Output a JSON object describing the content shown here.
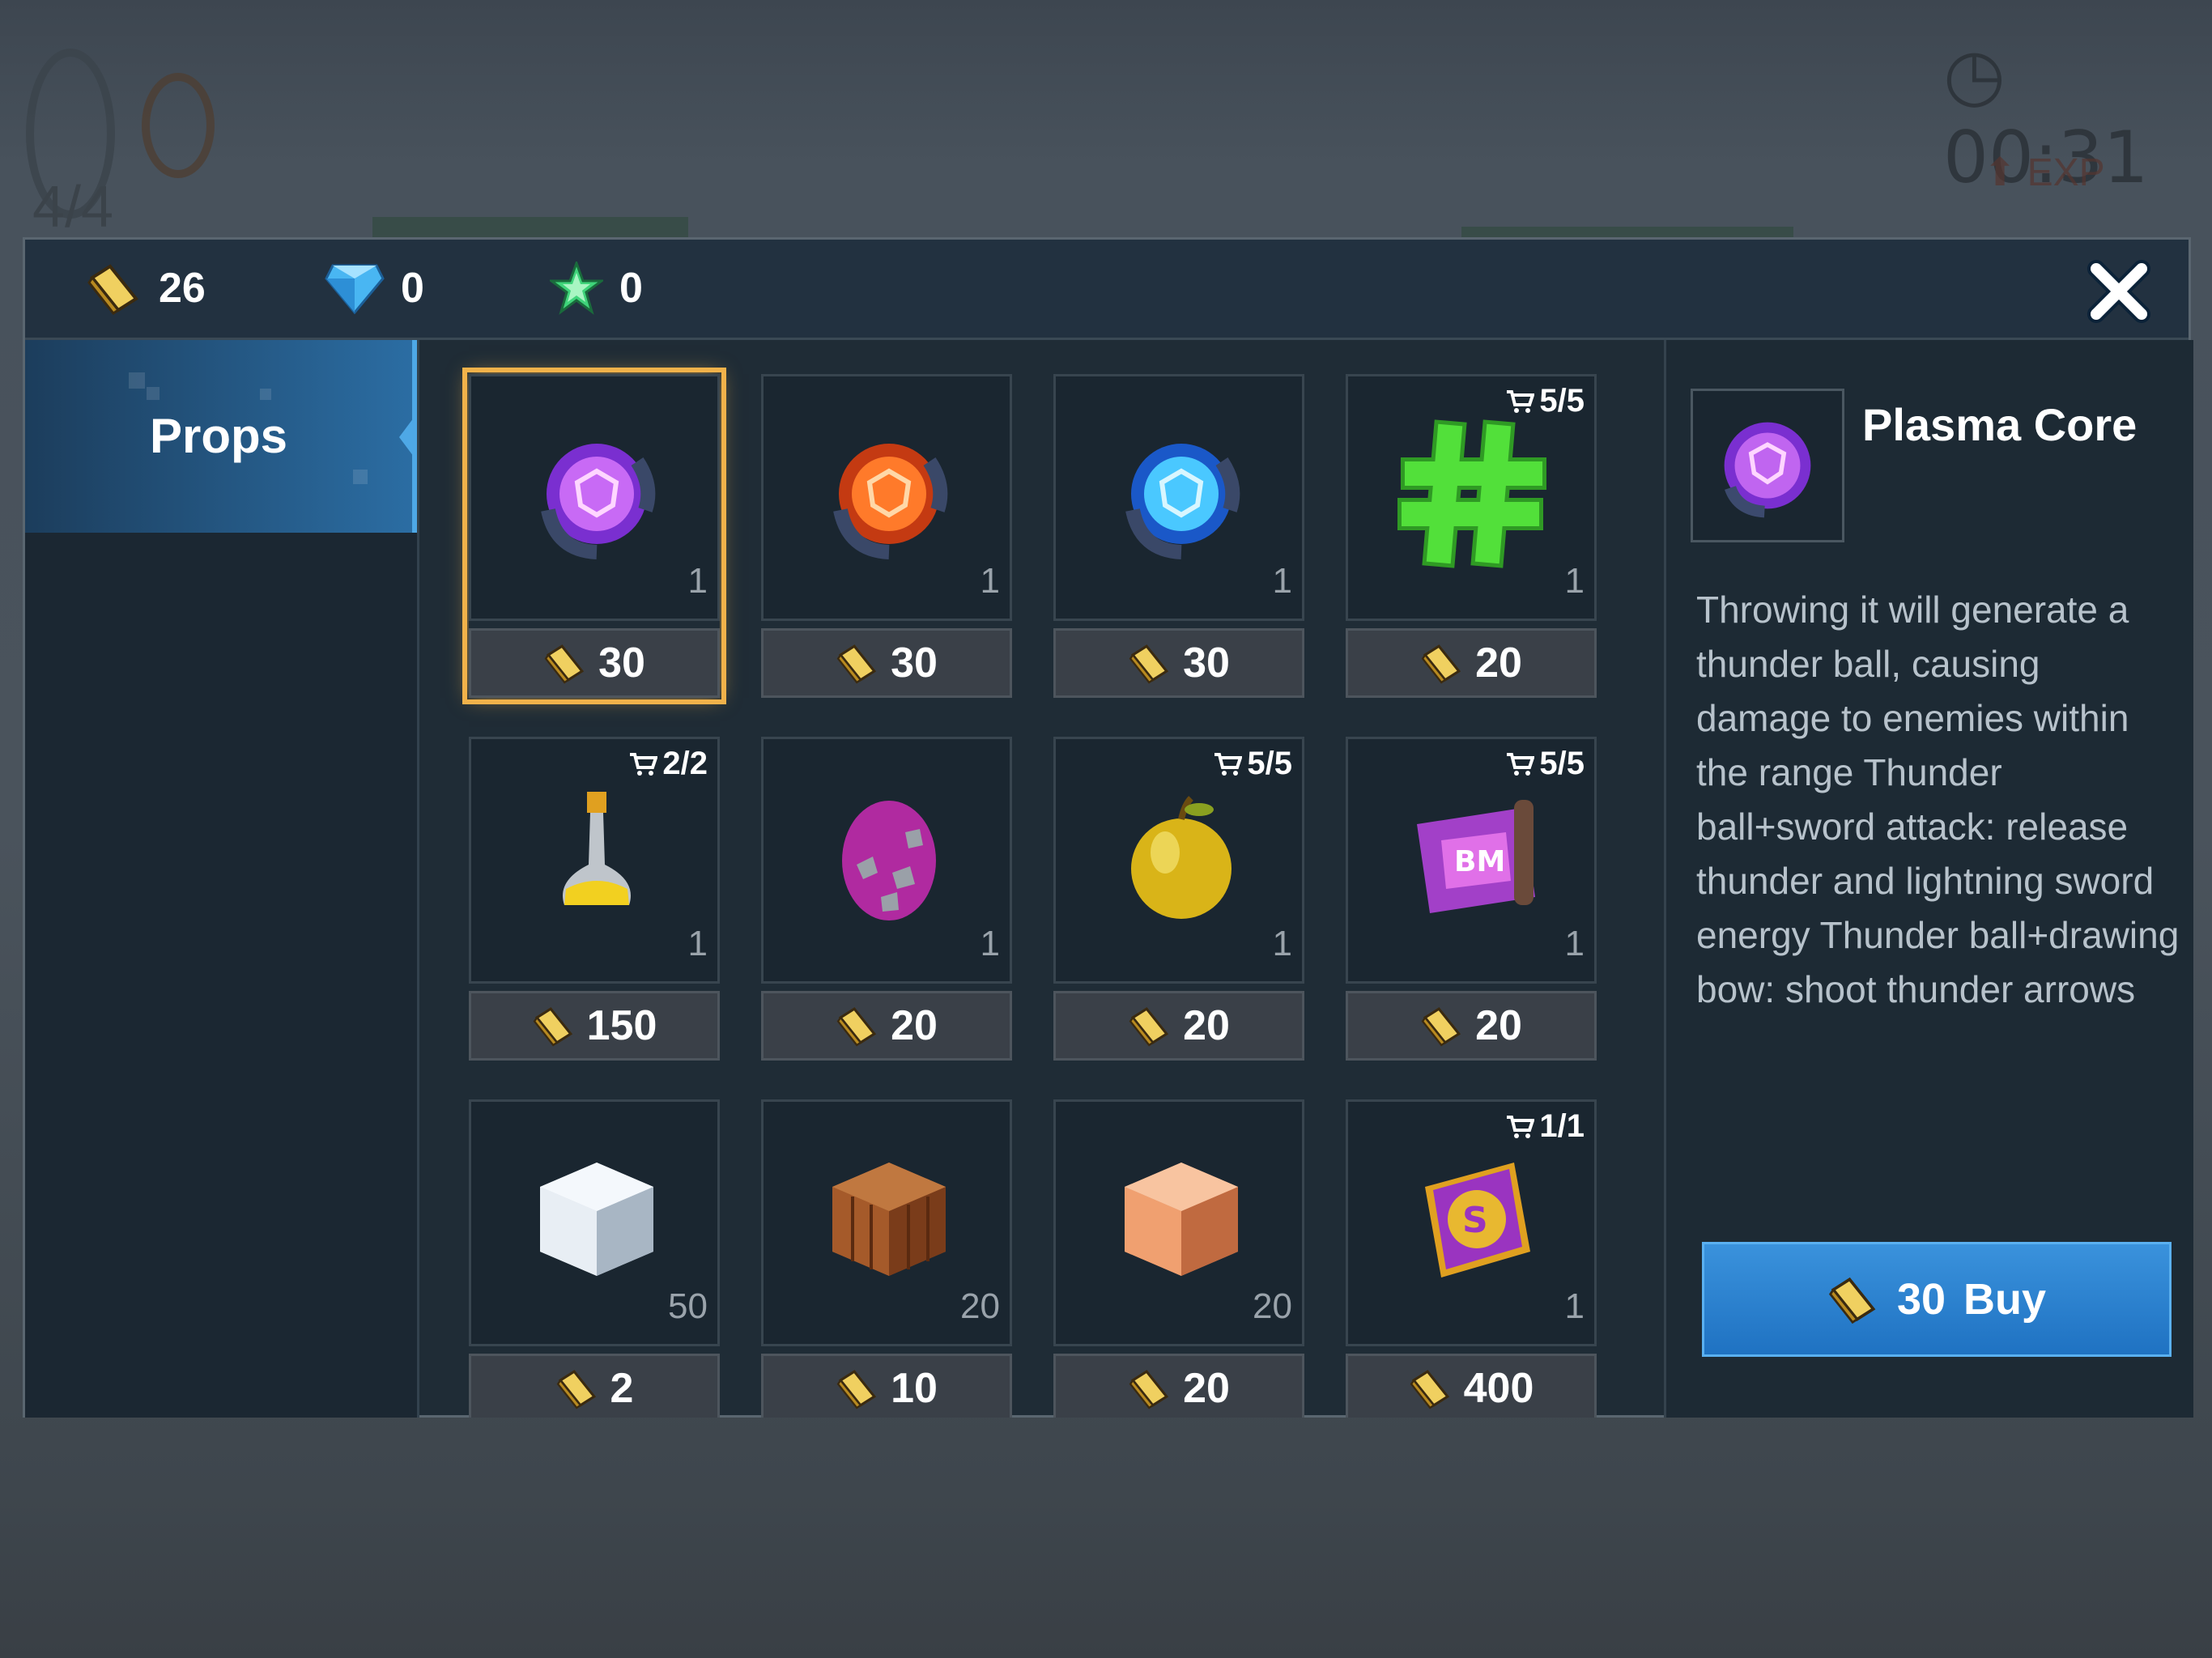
{
  "background": {
    "timer": "00:31",
    "exp_label": "EXP",
    "count": "4/4"
  },
  "currency": {
    "gold": "26",
    "diamond": "0",
    "star": "0"
  },
  "sidebar": {
    "tabs": [
      {
        "label": "Props"
      }
    ]
  },
  "items": [
    {
      "name": "plasma-core",
      "qty": "1",
      "price": "30",
      "limit": ""
    },
    {
      "name": "fire-core",
      "qty": "1",
      "price": "30",
      "limit": ""
    },
    {
      "name": "ice-core",
      "qty": "1",
      "price": "30",
      "limit": ""
    },
    {
      "name": "hashtag",
      "qty": "1",
      "price": "20",
      "limit": "5/5"
    },
    {
      "name": "potion",
      "qty": "1",
      "price": "150",
      "limit": "2/2"
    },
    {
      "name": "egg",
      "qty": "1",
      "price": "20",
      "limit": ""
    },
    {
      "name": "golden-apple",
      "qty": "1",
      "price": "20",
      "limit": "5/5"
    },
    {
      "name": "magic-carpet",
      "qty": "1",
      "price": "20",
      "limit": "5/5"
    },
    {
      "name": "white-block",
      "qty": "50",
      "price": "2",
      "limit": ""
    },
    {
      "name": "wood-crate",
      "qty": "20",
      "price": "10",
      "limit": ""
    },
    {
      "name": "copper-block",
      "qty": "20",
      "price": "20",
      "limit": ""
    },
    {
      "name": "spell-book",
      "qty": "1",
      "price": "400",
      "limit": "1/1"
    }
  ],
  "detail": {
    "name": "Plasma Core",
    "description": "Throwing it will generate a thunder ball, causing damage to enemies within the range Thunder ball+sword attack: release thunder and lightning sword energy Thunder ball+drawing bow: shoot thunder arrows",
    "buy_price": "30",
    "buy_label": "Buy"
  },
  "colors": {
    "selected_outline": "#f1b24a",
    "buy_button": "#2a82d0",
    "gold": "#e6c24a"
  }
}
